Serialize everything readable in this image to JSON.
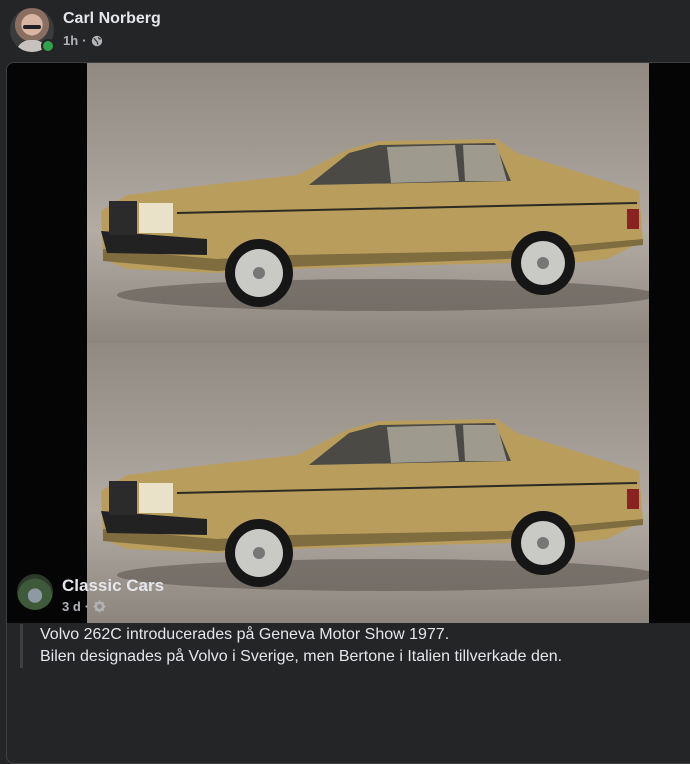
{
  "post": {
    "author": "Carl Norberg",
    "time": "1h",
    "separator": "·",
    "audience_icon": "globe-icon",
    "online_status_color": "#31a24c"
  },
  "shared_post": {
    "group_name": "Classic Cars",
    "time": "3 d",
    "separator": "·",
    "audience_icon": "gear-icon",
    "text_line_1": "Volvo 262C introducerades på Geneva Motor Show 1977.",
    "text_line_2": "Bilen designades på Volvo i Sverige, men Bertone i Italien tillverkade den."
  },
  "colors": {
    "background": "#242526",
    "primary_text": "#e4e6eb",
    "secondary_text": "#b0b3b8",
    "car_body": "#b89d5c"
  }
}
